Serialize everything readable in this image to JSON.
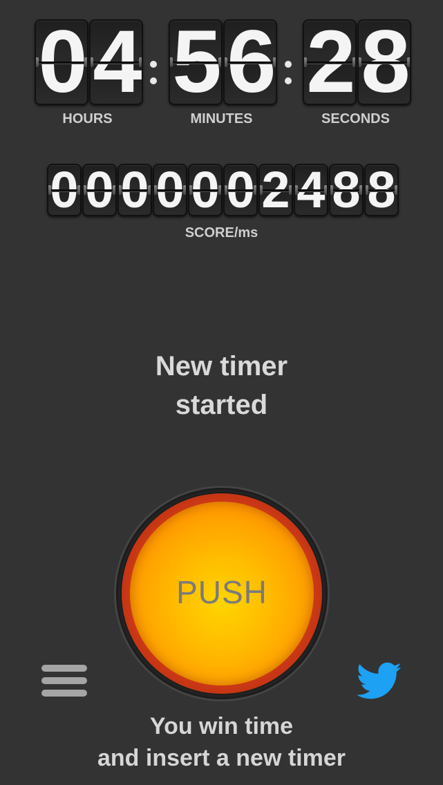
{
  "timer": {
    "hours": [
      "0",
      "4"
    ],
    "minutes": [
      "5",
      "6"
    ],
    "seconds": [
      "2",
      "8"
    ],
    "hours_label": "HOURS",
    "minutes_label": "MINUTES",
    "seconds_label": "SECONDS"
  },
  "score": {
    "digits": [
      "0",
      "0",
      "0",
      "0",
      "0",
      "0",
      "2",
      "4",
      "8",
      "8"
    ],
    "label": "SCORE/ms"
  },
  "message": {
    "line1": "New timer",
    "line2": "started"
  },
  "push_button": {
    "label": "PUSH"
  },
  "menu": {
    "icon": "hamburger-menu-icon"
  },
  "twitter": {
    "icon": "twitter-bird-icon",
    "color": "#1da1f2"
  },
  "footer": {
    "line1": "You win time",
    "line2": "and insert a new timer"
  },
  "colors": {
    "background": "#333333",
    "button_orange": "#ffb300",
    "button_ring": "#e8431a"
  }
}
